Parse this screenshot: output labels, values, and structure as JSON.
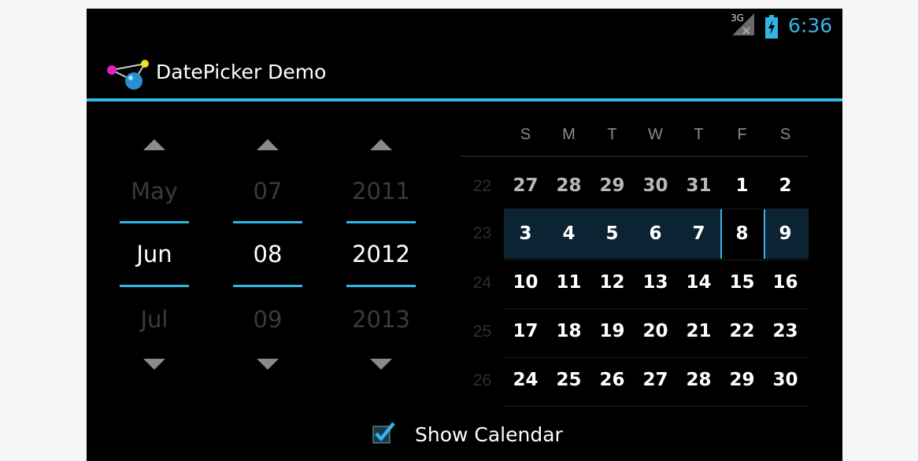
{
  "status_bar": {
    "signal_label": "3G",
    "time": "6:36"
  },
  "action_bar": {
    "title": "DatePicker Demo"
  },
  "picker": {
    "month": {
      "prev": "May",
      "current": "Jun",
      "next": "Jul"
    },
    "day": {
      "prev": "07",
      "current": "08",
      "next": "09"
    },
    "year": {
      "prev": "2011",
      "current": "2012",
      "next": "2013"
    }
  },
  "calendar": {
    "weekdays": [
      "S",
      "M",
      "T",
      "W",
      "T",
      "F",
      "S"
    ],
    "weeks": [
      {
        "number": "22",
        "days": [
          "27",
          "28",
          "29",
          "30",
          "31",
          "1",
          "2"
        ]
      },
      {
        "number": "23",
        "days": [
          "3",
          "4",
          "5",
          "6",
          "7",
          "8",
          "9"
        ]
      },
      {
        "number": "24",
        "days": [
          "10",
          "11",
          "12",
          "13",
          "14",
          "15",
          "16"
        ]
      },
      {
        "number": "25",
        "days": [
          "17",
          "18",
          "19",
          "20",
          "21",
          "22",
          "23"
        ]
      },
      {
        "number": "26",
        "days": [
          "24",
          "25",
          "26",
          "27",
          "28",
          "29",
          "30"
        ]
      }
    ]
  },
  "checkbox": {
    "label": "Show Calendar",
    "checked": true
  },
  "colors": {
    "accent": "#33b5e5",
    "background": "#000000",
    "selected_week": "#0b2333"
  }
}
